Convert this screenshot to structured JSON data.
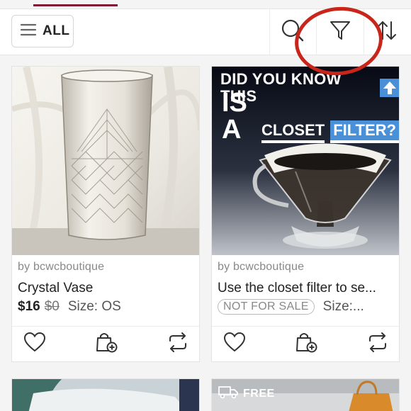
{
  "toolbar": {
    "all_label": "ALL"
  },
  "listings": [
    {
      "seller": "by bcwcboutique",
      "title": "Crystal Vase",
      "price": "$16",
      "original_price": "$0",
      "size": "Size: OS"
    },
    {
      "seller": "by bcwcboutique",
      "title": "Use the closet filter to se...",
      "badge": "NOT FOR SALE",
      "size": "Size:...",
      "image_text_line1": "DID YOU KNOW THIS",
      "image_text_line2a": "IS A",
      "image_text_line2b": "CLOSET",
      "image_text_line2c": "FILTER?"
    }
  ],
  "bottom_cards": {
    "free_label": "FREE"
  },
  "colors": {
    "accent": "#7f1734",
    "annotation": "#c8251b"
  },
  "icons": [
    "menu-icon",
    "search-icon",
    "filter-icon",
    "sort-icon",
    "heart-icon",
    "add-to-bundle-icon",
    "share-icon",
    "truck-icon"
  ]
}
